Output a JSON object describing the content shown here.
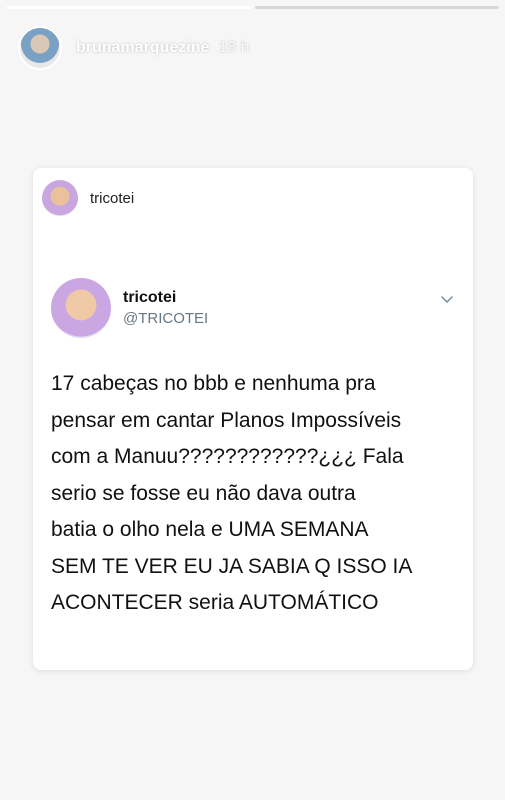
{
  "story": {
    "progress": [
      1.0,
      0.0
    ],
    "username": "brunamarquezine",
    "time": "18 h"
  },
  "card": {
    "top_username": "tricotei",
    "tweet": {
      "display_name": "tricotei",
      "handle": "@TRICOTEI",
      "text": "17 cabeças no bbb e nenhuma pra\npensar em cantar Planos Impossíveis\ncom a Manuu????????????¿¿¿ Fala\nserio se fosse eu não dava outra\nbatia o olho nela e UMA SEMANA\nSEM TE VER EU JA SABIA Q ISSO IA\nACONTECER seria AUTOMÁTICO"
    }
  },
  "icons": {
    "menu": "chevron-down-icon"
  }
}
